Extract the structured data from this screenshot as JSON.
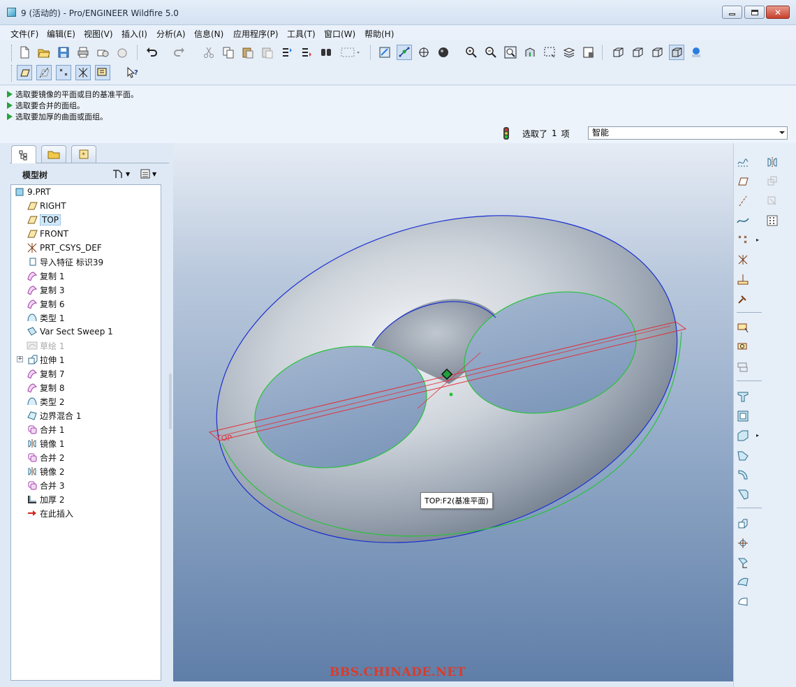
{
  "window": {
    "title": "9 (活动的) - Pro/ENGINEER Wildfire 5.0",
    "minimize_icon": "minimize-icon",
    "maximize_icon": "maximize-icon",
    "close_icon": "close-icon",
    "close_glyph": "✕"
  },
  "menubar": {
    "items": [
      {
        "label": "文件(F)"
      },
      {
        "label": "编辑(E)"
      },
      {
        "label": "视图(V)"
      },
      {
        "label": "插入(I)"
      },
      {
        "label": "分析(A)"
      },
      {
        "label": "信息(N)"
      },
      {
        "label": "应用程序(P)"
      },
      {
        "label": "工具(T)"
      },
      {
        "label": "窗口(W)"
      },
      {
        "label": "帮助(H)"
      }
    ]
  },
  "toolbar": {
    "row1": [
      "new-icon",
      "open-icon",
      "save-icon",
      "print-icon",
      "send-mail-icon",
      "send-link-icon",
      "undo-icon",
      "redo-icon",
      "cut-icon",
      "copy-icon",
      "paste-icon",
      "paste-special-icon",
      "regenerate-icon",
      "regen-manager-icon",
      "find-icon",
      "select-box-icon",
      "repaint-icon",
      "spin-center-icon",
      "orient-icon",
      "shading-icon",
      "zoom-in-icon",
      "zoom-out-icon",
      "refit-icon",
      "reorient-icon",
      "saved-views-icon",
      "layers-icon",
      "view-manager-icon",
      "wireframe-icon",
      "hidden-line-icon",
      "no-hidden-icon",
      "shaded-icon",
      "enhanced-realism-icon"
    ],
    "row2": [
      "datum-plane-display-icon",
      "datum-axis-display-icon",
      "datum-point-display-icon",
      "csys-display-icon",
      "annotation-display-icon",
      "context-help-icon"
    ]
  },
  "messages": {
    "lines": [
      "选取要镜像的平面或目的基准平面。",
      "选取要合并的面组。",
      "选取要加厚的曲面或面组。"
    ]
  },
  "status": {
    "traffic_light_icon": "traffic-light-icon",
    "selected_text": "选取了",
    "selected_count": "1",
    "selected_unit": "项",
    "filter_value": "智能"
  },
  "navigator": {
    "tabs": [
      "model-tree-tab-icon",
      "folder-browser-tab-icon",
      "favorites-tab-icon"
    ],
    "header_label": "模型树",
    "tree_tools_icon": "tree-settings-icon",
    "tree_view_icon": "tree-columns-icon",
    "items": [
      {
        "label": "9.PRT",
        "icon": "part-icon",
        "indent": 0
      },
      {
        "label": "RIGHT",
        "icon": "datum-plane-icon",
        "indent": 1
      },
      {
        "label": "TOP",
        "icon": "datum-plane-icon",
        "indent": 1,
        "selected": true
      },
      {
        "label": "FRONT",
        "icon": "datum-plane-icon",
        "indent": 1
      },
      {
        "label": "PRT_CSYS_DEF",
        "icon": "csys-icon",
        "indent": 1
      },
      {
        "label": "导入特征 标识39",
        "icon": "import-feature-icon",
        "indent": 1
      },
      {
        "label": "复制 1",
        "icon": "copy-surface-icon",
        "indent": 1
      },
      {
        "label": "复制 3",
        "icon": "copy-surface-icon",
        "indent": 1
      },
      {
        "label": "复制 6",
        "icon": "copy-surface-icon",
        "indent": 1
      },
      {
        "label": "类型 1",
        "icon": "surface-type-icon",
        "indent": 1
      },
      {
        "label": "Var Sect Sweep 1",
        "icon": "var-sect-sweep-icon",
        "indent": 1
      },
      {
        "label": "草绘 1",
        "icon": "sketch-icon",
        "indent": 1,
        "dimmed": true
      },
      {
        "label": "拉伸 1",
        "icon": "extrude-icon",
        "indent": 1,
        "expandable": true
      },
      {
        "label": "复制 7",
        "icon": "copy-surface-icon",
        "indent": 1
      },
      {
        "label": "复制 8",
        "icon": "copy-surface-icon",
        "indent": 1
      },
      {
        "label": "类型 2",
        "icon": "surface-type-icon",
        "indent": 1
      },
      {
        "label": "边界混合 1",
        "icon": "boundary-blend-icon",
        "indent": 1
      },
      {
        "label": "合并 1",
        "icon": "merge-icon",
        "indent": 1
      },
      {
        "label": "镜像 1",
        "icon": "mirror-icon",
        "indent": 1
      },
      {
        "label": "合并 2",
        "icon": "merge-icon",
        "indent": 1
      },
      {
        "label": "镜像 2",
        "icon": "mirror-icon",
        "indent": 1
      },
      {
        "label": "合并 3",
        "icon": "merge-icon",
        "indent": 1
      },
      {
        "label": "加厚 2",
        "icon": "thicken-icon",
        "indent": 1
      },
      {
        "label": "在此插入",
        "icon": "insert-here-arrow-icon",
        "indent": 1
      }
    ]
  },
  "graphics": {
    "datum_label": "TOP",
    "tooltip": "TOP:F2(基准平面)",
    "watermark": "BBS.CHINADE.NET",
    "colors": {
      "datum": "#e0303a",
      "edge_blue": "#1a2fcf",
      "edge_green": "#27c23a"
    }
  },
  "right_toolbar": {
    "icons": [
      "sketched-datum-curve-icon",
      "mirror-tool-icon",
      "datum-plane-tool-icon",
      "trim-tool-icon",
      "datum-axis-tool-icon",
      "merge-tool-icon",
      "datum-curve-tool-icon",
      "pattern-tool-icon",
      "datum-point-tool-icon",
      "datum-csys-tool-icon",
      "analysis-feature-icon",
      "sketch-tool-icon",
      "insert-model-datum-icon",
      "extrude-tool-icon",
      "revolve-tool-icon",
      "variable-sweep-tool-icon",
      "boundary-blend-tool-icon",
      "style-tool-icon",
      "hole-tool-icon",
      "shell-tool-icon",
      "rib-tool-icon",
      "draft-tool-icon",
      "round-tool-icon",
      "chamfer-tool-icon",
      "insert-feature-icon",
      "pattern-feature-icon",
      "warp-tool-icon",
      "freestyle-tool-icon",
      "surface-tool-icon"
    ]
  }
}
